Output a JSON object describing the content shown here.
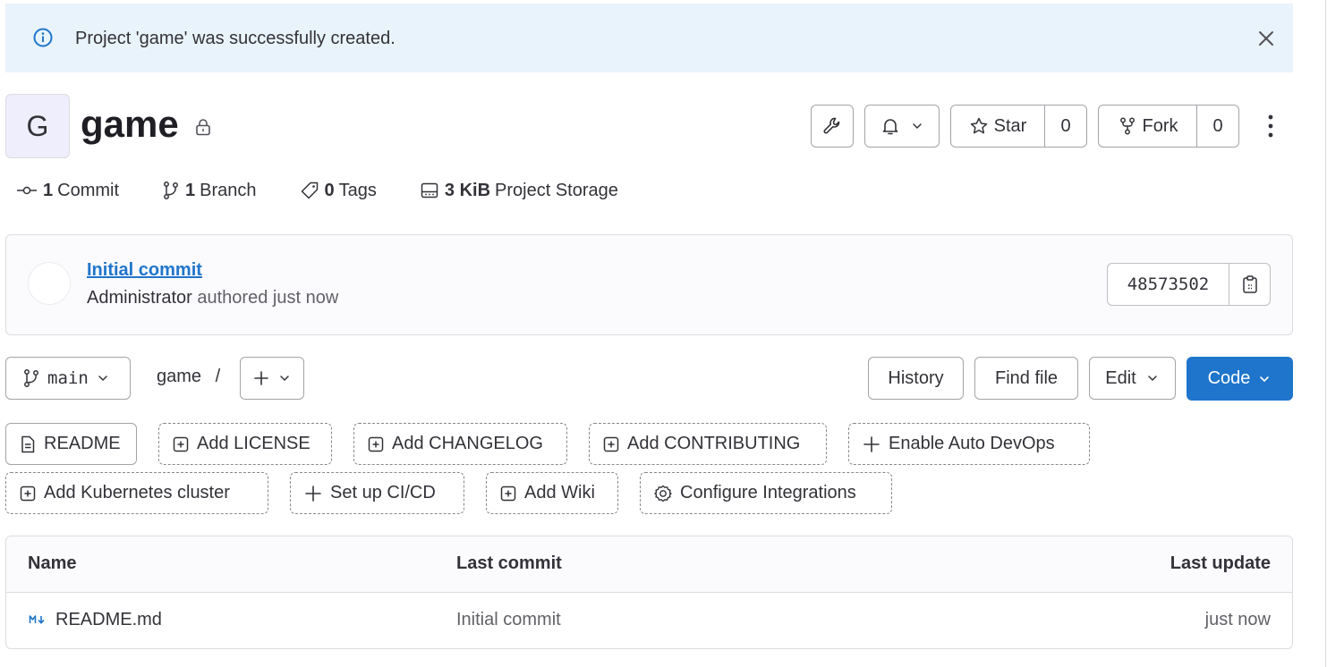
{
  "alert": {
    "message": "Project 'game' was successfully created."
  },
  "project": {
    "avatar_letter": "G",
    "name": "game"
  },
  "header_actions": {
    "star_label": "Star",
    "star_count": "0",
    "fork_label": "Fork",
    "fork_count": "0"
  },
  "stats": {
    "commits_count": "1",
    "commits_label": "Commit",
    "branches_count": "1",
    "branches_label": "Branch",
    "tags_count": "0",
    "tags_label": "Tags",
    "storage_size": "3 KiB",
    "storage_label": "Project Storage"
  },
  "last_commit": {
    "title": "Initial commit",
    "author": "Administrator",
    "meta": "authored just now",
    "sha": "48573502"
  },
  "toolbar": {
    "branch": "main",
    "path_root": "game",
    "path_separator": "/",
    "history_label": "History",
    "find_file_label": "Find file",
    "edit_label": "Edit",
    "code_label": "Code"
  },
  "suggestions": {
    "readme": "README",
    "add_license": "Add LICENSE",
    "add_changelog": "Add CHANGELOG",
    "add_contributing": "Add CONTRIBUTING",
    "enable_auto_devops": "Enable Auto DevOps",
    "add_kubernetes": "Add Kubernetes cluster",
    "setup_cicd": "Set up CI/CD",
    "add_wiki": "Add Wiki",
    "configure_integrations": "Configure Integrations"
  },
  "file_table": {
    "headers": {
      "name": "Name",
      "last_commit": "Last commit",
      "last_update": "Last update"
    },
    "rows": [
      {
        "name": "README.md",
        "last_commit": "Initial commit",
        "last_update": "just now"
      }
    ]
  },
  "colors": {
    "alert_bg": "#e9f3fc",
    "info_blue": "#1f75cb",
    "primary_button": "#1f75cb",
    "link": "#1f75cb"
  }
}
